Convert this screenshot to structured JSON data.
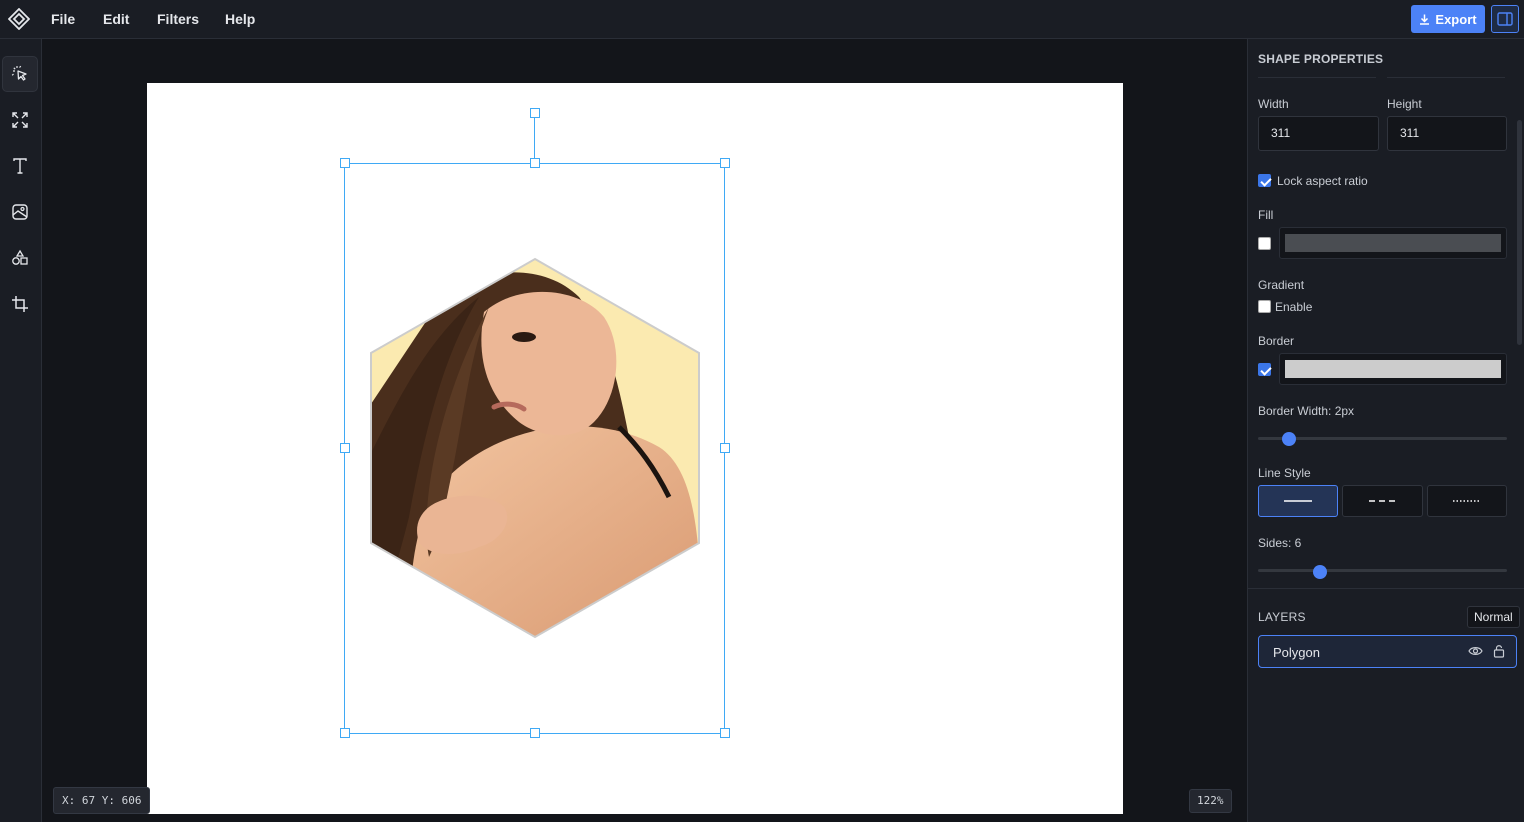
{
  "menu": {
    "file": "File",
    "edit": "Edit",
    "filters": "Filters",
    "help": "Help"
  },
  "toolbar": {
    "export_label": "Export",
    "tools": [
      "select-tool",
      "fit-tool",
      "text-tool",
      "image-tool",
      "shapes-tool",
      "crop-tool"
    ]
  },
  "canvas": {
    "coords": "X: 67 Y: 606",
    "zoom": "122%"
  },
  "shape_properties": {
    "title": "SHAPE PROPERTIES",
    "width_label": "Width",
    "height_label": "Height",
    "width_value": "311",
    "height_value": "311",
    "lock_aspect_label": "Lock aspect ratio",
    "lock_aspect_checked": true,
    "fill_label": "Fill",
    "fill_checked": false,
    "fill_color": "#4a4d52",
    "gradient_label": "Gradient",
    "gradient_enable_label": "Enable",
    "gradient_checked": false,
    "border_label": "Border",
    "border_checked": true,
    "border_color": "#cccccc",
    "border_width_label": "Border Width: 2px",
    "border_width_value": 2,
    "line_style_label": "Line Style",
    "line_styles": [
      "solid",
      "dashed",
      "dotted"
    ],
    "line_style_selected": "solid",
    "sides_label": "Sides: 6",
    "sides_value": 6
  },
  "layers": {
    "title": "LAYERS",
    "blend_mode": "Normal",
    "items": [
      {
        "name": "Polygon"
      }
    ]
  },
  "colors": {
    "accent": "#4c82f7",
    "selection": "#3fa9f5",
    "panel_bg": "#1a1d24",
    "canvas_bg": "#13151a"
  }
}
